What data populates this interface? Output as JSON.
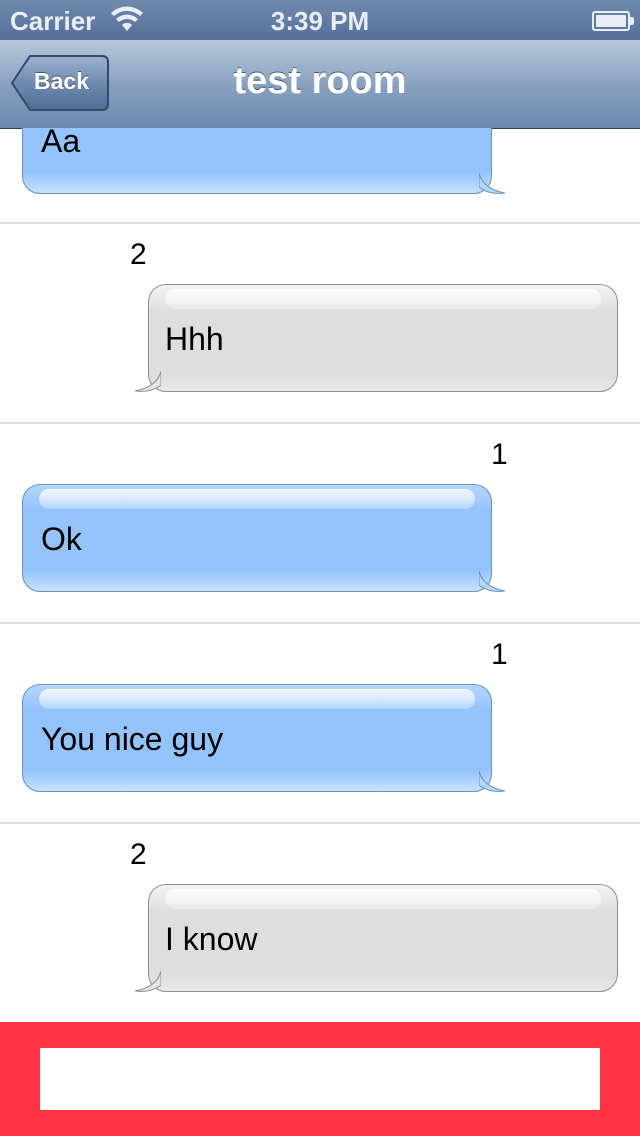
{
  "status_bar": {
    "carrier": "Carrier",
    "time": "3:39 PM"
  },
  "nav": {
    "back_label": "Back",
    "title": "test room"
  },
  "messages": [
    {
      "sender": "",
      "text": "Aa",
      "side": "right-bubble-blue"
    },
    {
      "sender": "2",
      "text": "Hhh",
      "side": "gray"
    },
    {
      "sender": "1",
      "text": "Ok",
      "side": "blue"
    },
    {
      "sender": "1",
      "text": "You nice guy",
      "side": "blue"
    },
    {
      "sender": "2",
      "text": "I know",
      "side": "gray"
    }
  ],
  "input": {
    "value": "",
    "placeholder": ""
  },
  "colors": {
    "input_bar": "#ff3341",
    "blue_bubble": "#93c3fb",
    "gray_bubble": "#dedede",
    "nav_bar": "#6d89ad"
  }
}
